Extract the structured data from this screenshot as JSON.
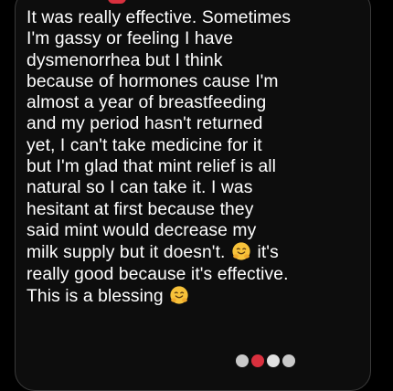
{
  "message": {
    "lines": [
      "It was really effective. Sometimes",
      "I'm gassy or feeling I have",
      "dysmenorrhea but I think",
      "because of hormones cause I'm",
      "almost a year of breastfeeding",
      "and my period hasn't returned",
      "yet, I can't take medicine for it",
      "but I'm glad that mint relief is all",
      "natural so I can take it. I was",
      "hesitant at first because they",
      "said mint would decrease my"
    ],
    "line_12_before": "milk supply but it doesn't.",
    "line_12_after": "it's",
    "line_13": "really good because it's effective.",
    "line_14": "This is a blessing"
  },
  "icons": {
    "hug_emoji": "hugging-face-emoji",
    "reaction_icons": [
      "reaction-icon",
      "heart-reaction-icon",
      "reaction-icon",
      "reaction-icon"
    ]
  },
  "colors": {
    "background": "#000000",
    "bubble_background": "#0d0d0d",
    "bubble_border": "#3a3a3a",
    "text": "#ffffff",
    "accent_red": "#d9303e",
    "emoji_yellow": "#f7c23a"
  }
}
